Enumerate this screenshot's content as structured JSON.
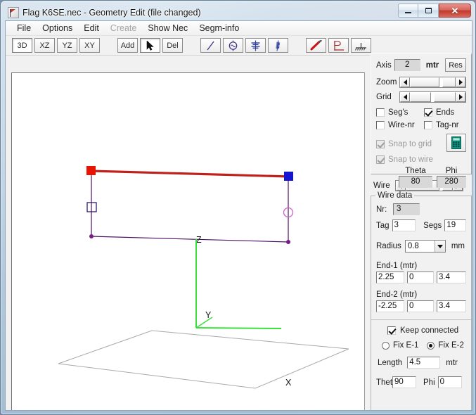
{
  "window": {
    "title": "Flag K6SE.nec - Geometry Edit (file changed)",
    "icon": "flag-icon",
    "buttons": {
      "minimize": "minimize-icon",
      "maximize": "maximize-icon",
      "close": "✕"
    }
  },
  "menu": [
    {
      "label": "File",
      "disabled": false
    },
    {
      "label": "Options",
      "disabled": false
    },
    {
      "label": "Edit",
      "disabled": false
    },
    {
      "label": "Create",
      "disabled": true
    },
    {
      "label": "Show Nec",
      "disabled": false
    },
    {
      "label": "Segm-info",
      "disabled": false
    }
  ],
  "toolbar": {
    "views": [
      {
        "label": "3D",
        "pressed": true
      },
      {
        "label": "XZ",
        "pressed": false
      },
      {
        "label": "YZ",
        "pressed": false
      },
      {
        "label": "XY",
        "pressed": false
      }
    ],
    "edit": [
      {
        "label": "Add",
        "icon": "",
        "pressed": false
      },
      {
        "label": "",
        "icon": "cursor-arrow-icon",
        "pressed": true
      },
      {
        "label": "Del",
        "icon": "",
        "pressed": false
      }
    ],
    "elements": [
      {
        "icon": "wire-line-icon"
      },
      {
        "icon": "source-icon"
      },
      {
        "icon": "load-icon"
      },
      {
        "icon": "coil-icon"
      }
    ],
    "tools": [
      {
        "icon": "pen-icon"
      },
      {
        "icon": "flag-ground-icon"
      },
      {
        "icon": "ground-plane-icon"
      }
    ]
  },
  "view_panel": {
    "axis_label": "Axis",
    "axis_value": "2",
    "unit_label": "mtr",
    "res_button": "Res",
    "zoom_label": "Zoom",
    "grid_label": "Grid",
    "checkboxes": [
      {
        "label": "Seg's",
        "checked": false,
        "disabled": false
      },
      {
        "label": "Ends",
        "checked": true,
        "disabled": false
      },
      {
        "label": "Wire-nr",
        "checked": false,
        "disabled": false
      },
      {
        "label": "Tag-nr",
        "checked": false,
        "disabled": false
      },
      {
        "label": "Snap to grid",
        "checked": true,
        "disabled": true
      },
      {
        "label": "Snap to wire",
        "checked": true,
        "disabled": true
      }
    ],
    "calc_button": "calculator-icon",
    "theta_label": "Theta",
    "theta_value": "80",
    "phi_label": "Phi",
    "phi_value": "280"
  },
  "wire_selector": {
    "label": "Wire"
  },
  "wire_data": {
    "title": "Wire data",
    "nr_label": "Nr:",
    "nr_value": "3",
    "tag_label": "Tag",
    "tag_value": "3",
    "segs_label": "Segs",
    "segs_value": "19",
    "radius_label": "Radius",
    "radius_value": "0.8",
    "radius_unit": "mm",
    "end1_label": "End-1 (mtr)",
    "end1": {
      "x": "2.25",
      "y": "0",
      "z": "3.4"
    },
    "end2_label": "End-2 (mtr)",
    "end2": {
      "x": "-2.25",
      "y": "0",
      "z": "3.4"
    },
    "keep_connected_label": "Keep connected",
    "keep_connected": true,
    "fix_e1_label": "Fix E-1",
    "fix_e2_label": "Fix E-2",
    "fix_selected": "E-2",
    "length_label": "Length",
    "length_value": "4.5",
    "length_unit": "mtr",
    "theta_label": "Thet",
    "theta_value": "90",
    "phi_label": "Phi",
    "phi_value": "0"
  },
  "canvas": {
    "axis_labels": {
      "x": "X",
      "y": "Y",
      "z": "Z"
    },
    "colors": {
      "selected_wire": "#c0201a",
      "wire": "#4b1060",
      "axis": "#36dc36",
      "ground": "#a9a9a9",
      "end1_marker": "#e61400",
      "end2_marker": "#1414d2",
      "load_marker": "#2d1a6e",
      "source_marker": "#d060c8"
    }
  }
}
